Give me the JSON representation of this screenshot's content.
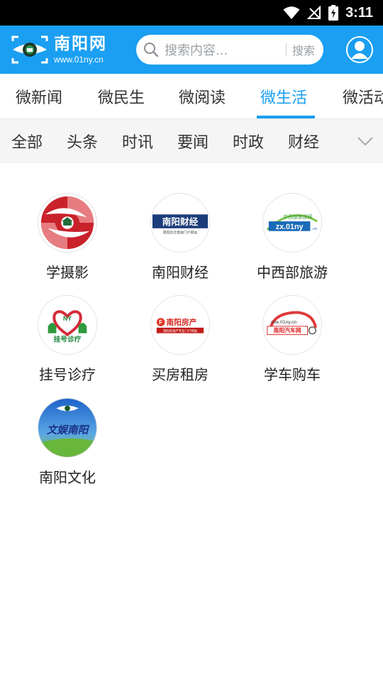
{
  "status_bar": {
    "time": "3:11"
  },
  "header": {
    "logo_title": "南阳网",
    "logo_url": "www.01ny.cn",
    "search_placeholder": "搜索内容...",
    "search_button": "搜索"
  },
  "tabs": [
    {
      "label": "微新闻",
      "active": false
    },
    {
      "label": "微民生",
      "active": false
    },
    {
      "label": "微阅读",
      "active": false
    },
    {
      "label": "微生活",
      "active": true
    },
    {
      "label": "微活动",
      "active": false
    }
  ],
  "subcategories": [
    "全部",
    "头条",
    "时讯",
    "要闻",
    "时政",
    "财经"
  ],
  "grid": [
    {
      "label": "学摄影",
      "icon": "photography-icon"
    },
    {
      "label": "南阳财经",
      "icon": "nanyang-finance-logo",
      "logo_text": "南阳财经",
      "logo_sub": "南阳综合金融门户网站"
    },
    {
      "label": "中西部旅游",
      "icon": "travel-logo",
      "logo_text": "zx.01ny",
      "logo_top": "中西部旅游网",
      "logo_suffix": ".cn"
    },
    {
      "label": "挂号诊疗",
      "icon": "hospital-registration-logo",
      "logo_text": "挂号诊疗",
      "logo_badge": "NY"
    },
    {
      "label": "买房租房",
      "icon": "nanyang-realestate-logo",
      "logo_text": "南阳房产",
      "logo_sub": "南阳房地产专业门户网站"
    },
    {
      "label": "学车购车",
      "icon": "nanyang-auto-logo",
      "logo_top": "che.01ny.cn",
      "logo_text": "南阳汽车网"
    },
    {
      "label": "南阳文化",
      "icon": "nanyang-culture-logo",
      "logo_text": "文娱南阳"
    }
  ],
  "colors": {
    "brand": "#1a9ff2",
    "active_tab": "#1a9ff2",
    "text": "#333333"
  }
}
